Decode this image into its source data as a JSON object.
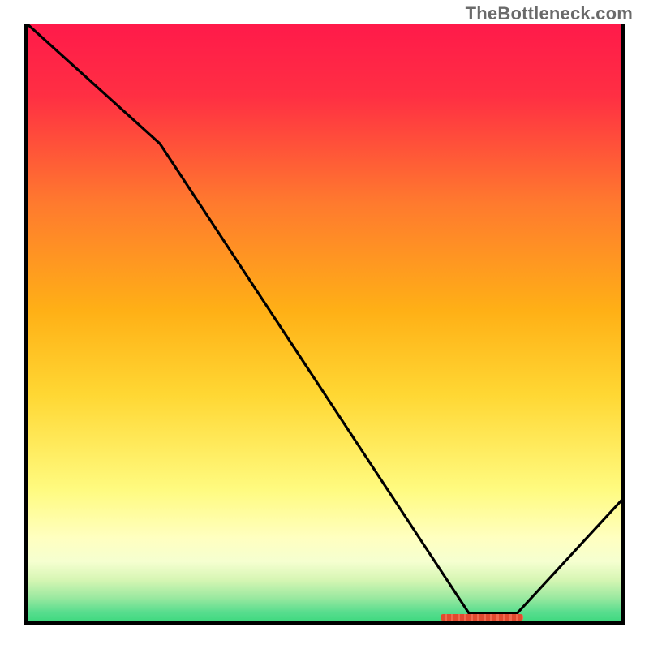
{
  "watermark": "TheBottleneck.com",
  "chart_data": {
    "type": "line",
    "title": "",
    "xlabel": "",
    "ylabel": "",
    "xlim": [
      0,
      100
    ],
    "ylim": [
      0,
      100
    ],
    "x": [
      0,
      22,
      74,
      82,
      100
    ],
    "values": [
      100,
      80,
      1,
      1,
      20
    ],
    "annotations": [
      {
        "name": "optimal-range-marker",
        "x_start": 70,
        "x_end": 84,
        "y": 0
      }
    ],
    "background_gradient": [
      "#ff1a4a",
      "#ffd733",
      "#ffffb0",
      "#3fd97f"
    ]
  }
}
